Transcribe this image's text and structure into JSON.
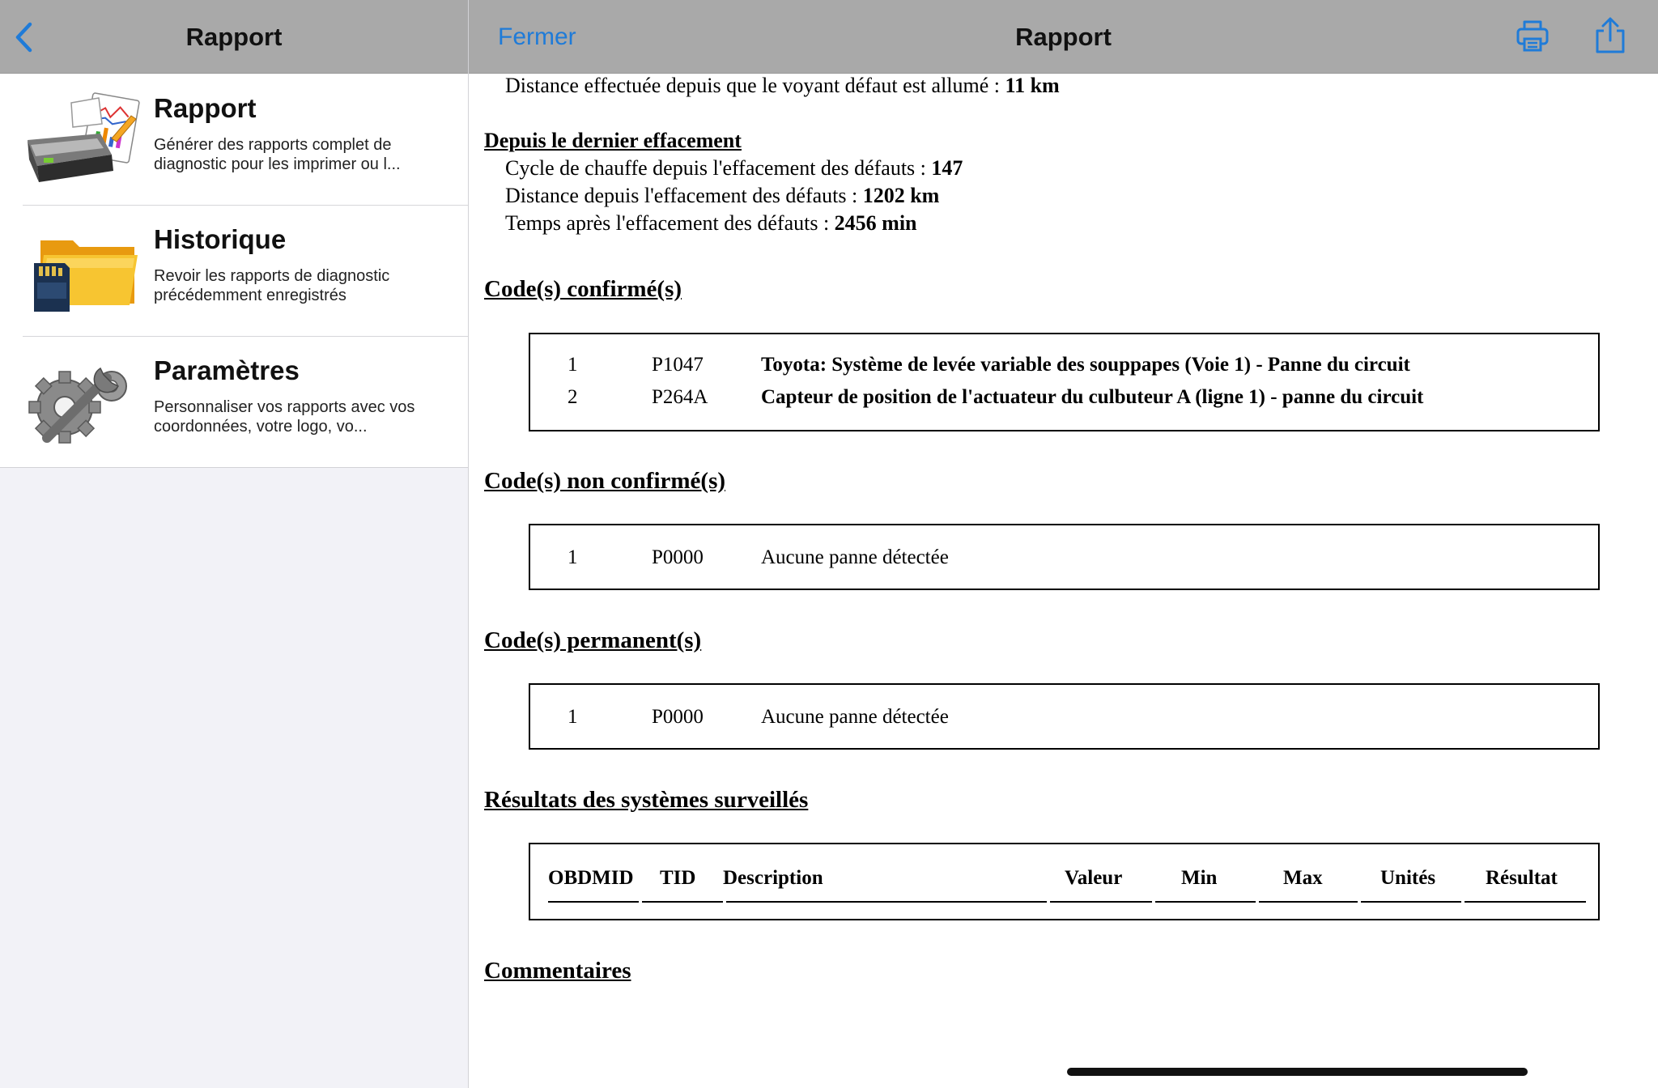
{
  "sidebar": {
    "title": "Rapport",
    "items": [
      {
        "name": "Rapport",
        "description": "Générer des rapports complet de diagnostic pour les imprimer ou l...",
        "icon": "printer-report-icon"
      },
      {
        "name": "Historique",
        "description": "Revoir les rapports de diagnostic précédemment enregistrés",
        "icon": "folder-sd-card-icon"
      },
      {
        "name": "Paramètres",
        "description": "Personnaliser vos rapports avec vos coordonnées, votre logo, vo...",
        "icon": "gears-wrench-icon"
      }
    ]
  },
  "main_nav": {
    "close_label": "Fermer",
    "title": "Rapport"
  },
  "report": {
    "mil_distance_label": "Distance effectuée depuis que le voyant défaut est allumé : ",
    "mil_distance_value": "11 km",
    "since_clear_title": "Depuis le dernier effacement",
    "since_clear": [
      {
        "label": "Cycle de chauffe depuis l'effacement des défauts : ",
        "value": "147"
      },
      {
        "label": "Distance depuis l'effacement des défauts : ",
        "value": "1202 km"
      },
      {
        "label": "Temps après l'effacement des défauts : ",
        "value": "2456 min"
      }
    ],
    "confirmed_title": "Code(s) confirmé(s)",
    "confirmed": [
      {
        "num": "1",
        "code": "P1047",
        "desc": "Toyota: Système de levée variable des souppapes (Voie 1) - Panne du circuit"
      },
      {
        "num": "2",
        "code": "P264A",
        "desc": "Capteur de position de l'actuateur du culbuteur A (ligne 1) - panne du circuit"
      }
    ],
    "unconfirmed_title": "Code(s) non confirmé(s)",
    "unconfirmed": [
      {
        "num": "1",
        "code": "P0000",
        "desc": "Aucune panne détectée"
      }
    ],
    "permanent_title": "Code(s) permanent(s)",
    "permanent": [
      {
        "num": "1",
        "code": "P0000",
        "desc": "Aucune panne détectée"
      }
    ],
    "monitored_title": "Résultats des systèmes surveillés",
    "monitored_headers": [
      "OBDMID",
      "TID",
      "Description",
      "Valeur",
      "Min",
      "Max",
      "Unités",
      "Résultat"
    ],
    "comments_title": "Commentaires"
  },
  "colors": {
    "accent": "#1f7bd8",
    "nav_bar": "#a9a9a9",
    "sidebar_bg": "#f2f2f7"
  }
}
